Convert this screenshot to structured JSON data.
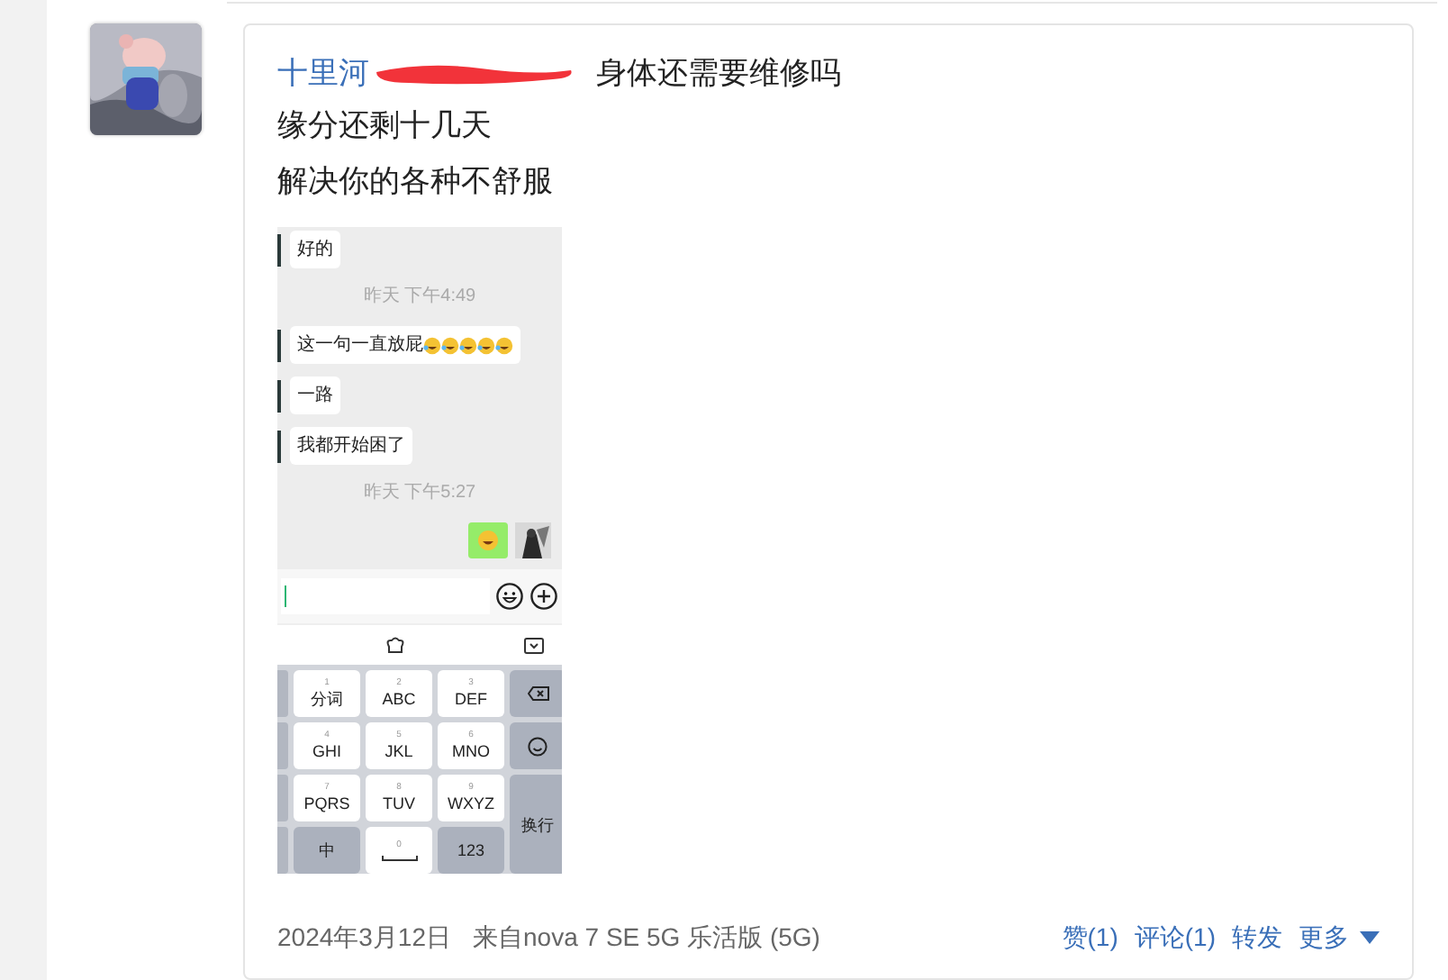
{
  "post": {
    "author": "十里河",
    "author_redacted": true,
    "lines": [
      "身体还需要维修吗",
      "缘分还剩十几天",
      "解决你的各种不舒服"
    ],
    "screenshot": {
      "messages": [
        {
          "kind": "received",
          "text": "好的"
        },
        {
          "kind": "time",
          "text": "昨天 下午4:49"
        },
        {
          "kind": "received_emoji",
          "text": "这一句一直放屁"
        },
        {
          "kind": "received",
          "text": "一路"
        },
        {
          "kind": "received",
          "text": "我都开始困了"
        },
        {
          "kind": "time",
          "text": "昨天 下午5:27"
        },
        {
          "kind": "sent_sticker"
        }
      ],
      "keys": [
        {
          "kind": "letter",
          "label": "分词",
          "sub": "1"
        },
        {
          "kind": "letter",
          "label": "ABC",
          "sub": "2"
        },
        {
          "kind": "letter",
          "label": "DEF",
          "sub": "3"
        },
        {
          "kind": "backspace"
        },
        {
          "kind": "letter",
          "label": "GHI",
          "sub": "4"
        },
        {
          "kind": "letter",
          "label": "JKL",
          "sub": "5"
        },
        {
          "kind": "letter",
          "label": "MNO",
          "sub": "6"
        },
        {
          "kind": "emoji"
        },
        {
          "kind": "letter",
          "label": "PQRS",
          "sub": "7"
        },
        {
          "kind": "letter",
          "label": "TUV",
          "sub": "8"
        },
        {
          "kind": "letter",
          "label": "WXYZ",
          "sub": "9"
        },
        {
          "kind": "enter",
          "label": "换行"
        },
        {
          "kind": "function",
          "label": "中"
        },
        {
          "kind": "space",
          "sub": "0"
        },
        {
          "kind": "function",
          "label": "123"
        }
      ]
    },
    "date": "2024年3月12日",
    "source": "来自nova 7 SE 5G 乐活版 (5G)",
    "actions": [
      {
        "kind": "link",
        "label": "赞(1)"
      },
      {
        "kind": "link",
        "label": "评论(1)"
      },
      {
        "kind": "link",
        "label": "转发"
      },
      {
        "kind": "menu",
        "label": "更多"
      }
    ]
  }
}
